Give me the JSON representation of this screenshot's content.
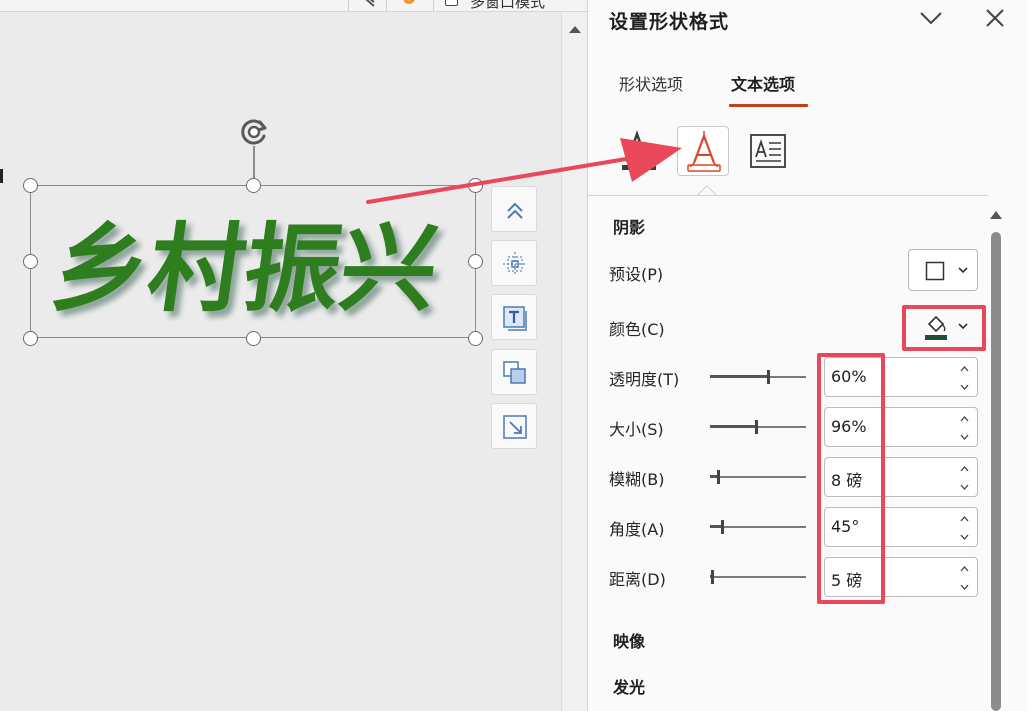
{
  "toolbar": {
    "multi_window_label": "多窗口模式"
  },
  "art_text": {
    "text": "乡村振兴",
    "color": "#2e7d1f"
  },
  "pane": {
    "title": "设置形状格式",
    "tabs": [
      {
        "label": "形状选项",
        "active": false
      },
      {
        "label": "文本选项",
        "active": true
      }
    ],
    "subtabs": [
      {
        "icon": "text-fill-outline-icon",
        "active": false
      },
      {
        "icon": "text-effects-icon",
        "active": true
      },
      {
        "icon": "textbox-layout-icon",
        "active": false
      }
    ],
    "sections": {
      "shadow": "阴影",
      "reflection": "映像",
      "glow": "发光"
    },
    "shadow": {
      "preset_label": "预设(P)",
      "color_label": "颜色(C)",
      "color_swatch": "#1e4d3a",
      "rows": [
        {
          "label": "透明度(T)",
          "value": "60%",
          "fraction": 0.6
        },
        {
          "label": "大小(S)",
          "value": "96%",
          "fraction": 0.48
        },
        {
          "label": "模糊(B)",
          "value": "8 磅",
          "fraction": 0.08
        },
        {
          "label": "角度(A)",
          "value": "45°",
          "fraction": 0.125
        },
        {
          "label": "距离(D)",
          "value": "5 磅",
          "fraction": 0.025
        }
      ]
    }
  },
  "colors": {
    "accent": "#c43e1c",
    "annotation": "#e8485a"
  }
}
